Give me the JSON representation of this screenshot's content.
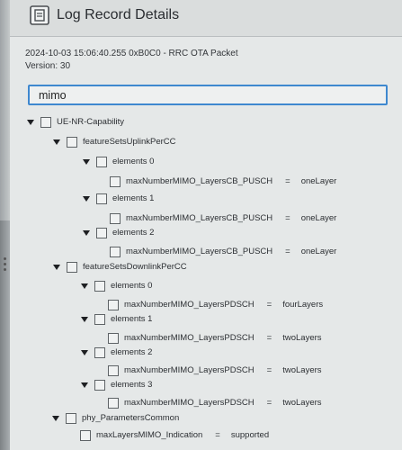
{
  "window": {
    "title": "Log Record Details",
    "title_icon": "log-details-icon"
  },
  "record": {
    "header": "2024-10-03 15:06:40.255   0xB0C0 - RRC OTA Packet",
    "version": "Version: 30"
  },
  "search": {
    "value": "mimo",
    "placeholder": ""
  },
  "tree": {
    "root": "UE-NR-Capability",
    "uplink": {
      "label": "featureSetsUplinkPerCC",
      "elements": [
        {
          "label": "elements 0",
          "field": "maxNumberMIMO_LayersCB_PUSCH",
          "eq": "=",
          "value": "oneLayer"
        },
        {
          "label": "elements 1",
          "field": "maxNumberMIMO_LayersCB_PUSCH",
          "eq": "=",
          "value": "oneLayer"
        },
        {
          "label": "elements 2",
          "field": "maxNumberMIMO_LayersCB_PUSCH",
          "eq": "=",
          "value": "oneLayer"
        }
      ]
    },
    "downlink": {
      "label": "featureSetsDownlinkPerCC",
      "elements": [
        {
          "label": "elements 0",
          "field": "maxNumberMIMO_LayersPDSCH",
          "eq": "=",
          "value": "fourLayers"
        },
        {
          "label": "elements 1",
          "field": "maxNumberMIMO_LayersPDSCH",
          "eq": "=",
          "value": "twoLayers"
        },
        {
          "label": "elements 2",
          "field": "maxNumberMIMO_LayersPDSCH",
          "eq": "=",
          "value": "twoLayers"
        },
        {
          "label": "elements 3",
          "field": "maxNumberMIMO_LayersPDSCH",
          "eq": "=",
          "value": "twoLayers"
        }
      ]
    },
    "phy": {
      "label": "phy_ParametersCommon",
      "field": "maxLayersMIMO_Indication",
      "eq": "=",
      "value": "supported"
    }
  },
  "colors": {
    "accent": "#3e88cf",
    "background": "#e5e8e8",
    "text": "#2c2f33"
  }
}
